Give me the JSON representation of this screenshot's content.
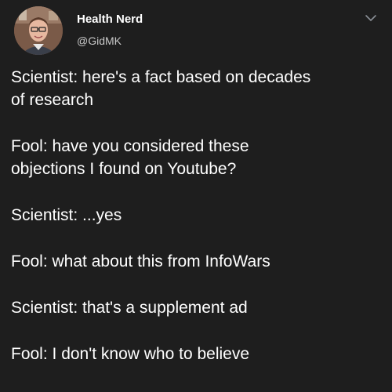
{
  "author": {
    "display_name": "Health Nerd",
    "handle": "@GidMK",
    "avatar_icon": "profile-photo",
    "menu_icon": "chevron-down-icon"
  },
  "tweet": {
    "paragraphs": [
      {
        "lines": [
          "Scientist: here's a fact based on decades",
          "of research"
        ]
      },
      {
        "lines": [
          "Fool: have you considered these",
          "objections I found on Youtube?"
        ]
      },
      {
        "lines": [
          "Scientist: ...yes"
        ]
      },
      {
        "lines": [
          "Fool: what about this from InfoWars"
        ]
      },
      {
        "lines": [
          "Scientist: that's a supplement ad"
        ]
      },
      {
        "lines": [
          "Fool: I don't know who to believe"
        ]
      }
    ]
  },
  "colors": {
    "background": "#1e1e1e",
    "text": "#ffffff",
    "handle": "#c8c8c8"
  }
}
